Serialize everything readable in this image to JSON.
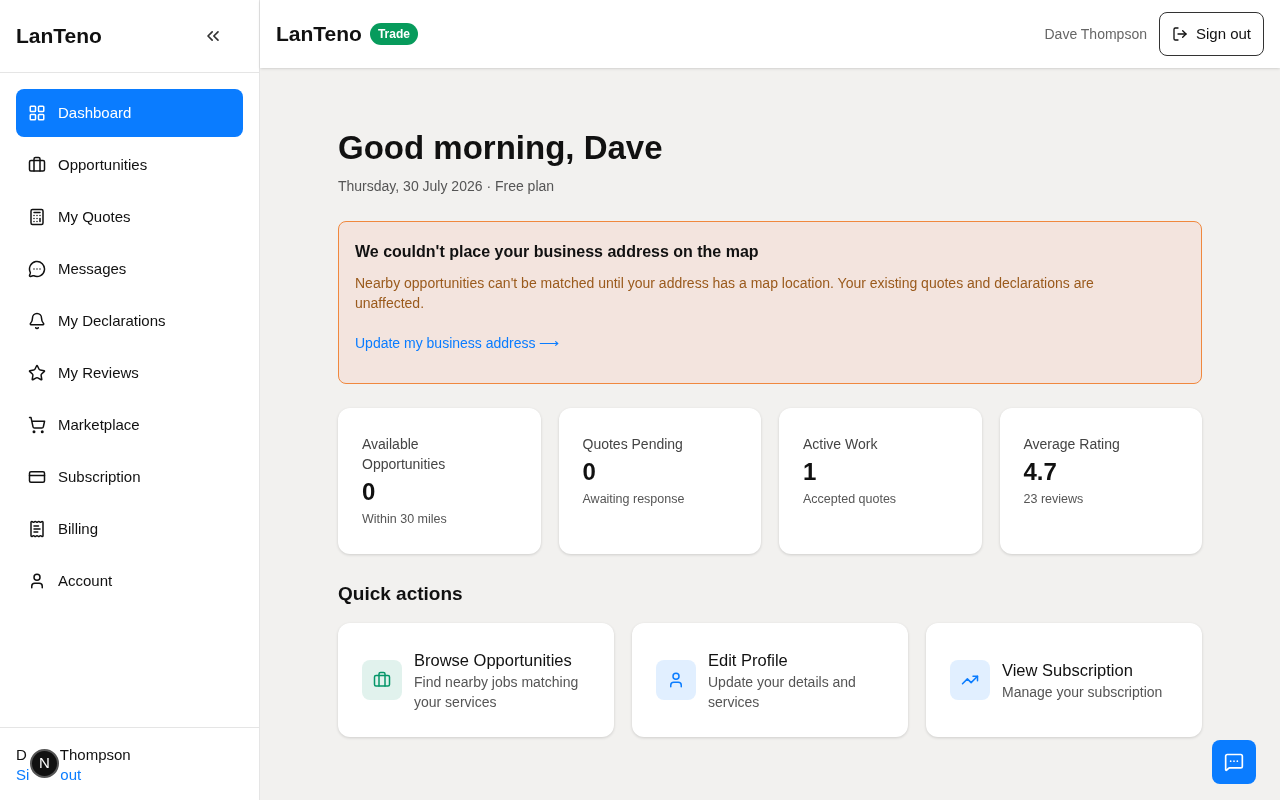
{
  "sidebar": {
    "logo": "LanTeno",
    "items": [
      {
        "label": "Dashboard",
        "selected": true
      },
      {
        "label": "Opportunities",
        "selected": false
      },
      {
        "label": "My Quotes",
        "selected": false
      },
      {
        "label": "Messages",
        "selected": false
      },
      {
        "label": "My Declarations",
        "selected": false
      },
      {
        "label": "My Reviews",
        "selected": false
      },
      {
        "label": "Marketplace",
        "selected": false
      },
      {
        "label": "Subscription",
        "selected": false
      },
      {
        "label": "Billing",
        "selected": false
      },
      {
        "label": "Account",
        "selected": false
      }
    ],
    "user": {
      "name_parts": [
        "D",
        "Thompson"
      ],
      "sign_out_parts": [
        "Si",
        "out"
      ]
    },
    "dev_badge": "N"
  },
  "header": {
    "brand": "LanTeno",
    "badge": "Trade",
    "user_name": "Dave Thompson",
    "sign_out": "Sign out"
  },
  "greeting": {
    "title": "Good morning, Dave",
    "subtitle": "Thursday, 30 July 2026 · Free plan"
  },
  "alert": {
    "title": "We couldn't place your business address on the map",
    "text": "Nearby opportunities can't be matched until your address has a map location. Your existing quotes and declarations are unaffected.",
    "link": "Update my business address ⟶"
  },
  "stats": [
    {
      "label": "Available Opportunities",
      "value": "0",
      "note": "Within 30 miles"
    },
    {
      "label": "Quotes Pending",
      "value": "0",
      "note": "Awaiting response"
    },
    {
      "label": "Active Work",
      "value": "1",
      "note": "Accepted quotes"
    },
    {
      "label": "Average Rating",
      "value": "4.7",
      "note": "23 reviews"
    }
  ],
  "quick_actions": {
    "title": "Quick actions",
    "items": [
      {
        "title": "Browse Opportunities",
        "text": "Find nearby jobs matching your services",
        "color": "#059669"
      },
      {
        "title": "Edit Profile",
        "text": "Update your details and services",
        "color": "#0a7cff"
      },
      {
        "title": "View Subscription",
        "text": "Manage your subscription",
        "color": "#0a7cff"
      }
    ]
  }
}
